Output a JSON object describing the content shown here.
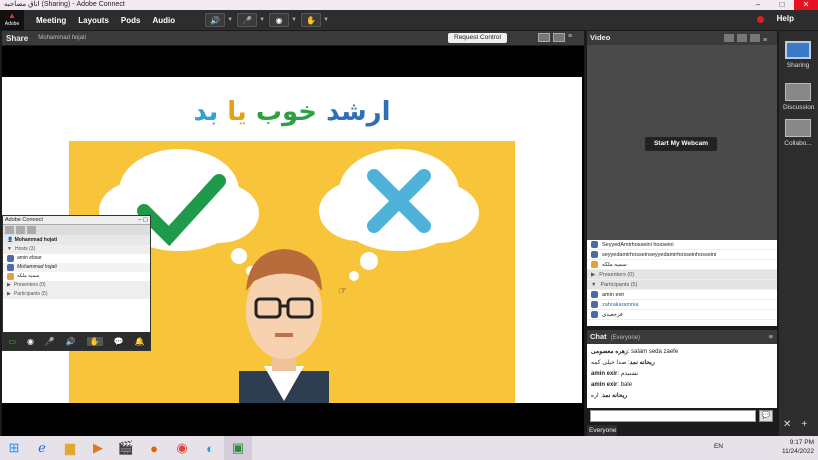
{
  "window": {
    "title": "اتاق مصاحبه (Sharing) - Adobe Connect"
  },
  "menubar": {
    "logo": "Adobe",
    "items": [
      "Meeting",
      "Layouts",
      "Pods",
      "Audio"
    ],
    "help": "Help"
  },
  "share_pod": {
    "title": "Share",
    "presenter": "Mohammad hojati",
    "request_control": "Request Control"
  },
  "slide": {
    "title_parts": [
      {
        "text": "ارشد ",
        "color": "#2e6fb7"
      },
      {
        "text": "خوب ",
        "color": "#2ea043"
      },
      {
        "text": "یا ",
        "color": "#e3a019"
      },
      {
        "text": "بد",
        "color": "#2fa3d6"
      }
    ]
  },
  "video_pod": {
    "title": "Video",
    "webcam_button": "Start My Webcam"
  },
  "attendees": {
    "rows_top": [
      "SeyyedAmirhosseini hosseini",
      "seyyedamirhosseinseyyedamirhosseinhosseini",
      "سمیه ملکه"
    ],
    "presenters_section": "Presenters (0)",
    "participants_section": "Participants (5)",
    "participants": [
      "amin exir",
      "zahrakaramnia",
      "فرجعیدی"
    ]
  },
  "chat_pod": {
    "title": "Chat",
    "scope": "(Everyone)",
    "messages": [
      {
        "from": "زهره معصومی",
        "text": "salam seda zaefe"
      },
      {
        "from": "ریحانه نمد",
        "text": "صدا خیلی کمه"
      },
      {
        "from": "amin exir",
        "text": "نشنیدم"
      },
      {
        "from": "amin exir",
        "text": "bale"
      },
      {
        "from": "ریحانه نمد",
        "text": "اره"
      }
    ],
    "target": "Everyone"
  },
  "layouts": [
    {
      "label": "Sharing",
      "selected": true
    },
    {
      "label": "Discussion",
      "selected": false
    },
    {
      "label": "Collabo...",
      "selected": false
    }
  ],
  "mini_window": {
    "title": "Adobe Connect",
    "selected_user": "Mohammad hojati",
    "hosts_section": "Hosts (3)",
    "hosts": [
      "amin ebsar",
      "Mohammad hojati",
      "سمیه ملکه"
    ],
    "presenters_section": "Presenters (0)",
    "participants_section": "Participants (5)"
  },
  "taskbar": {
    "lang": "EN",
    "time": "9:17 PM",
    "date": "11/24/2022"
  }
}
